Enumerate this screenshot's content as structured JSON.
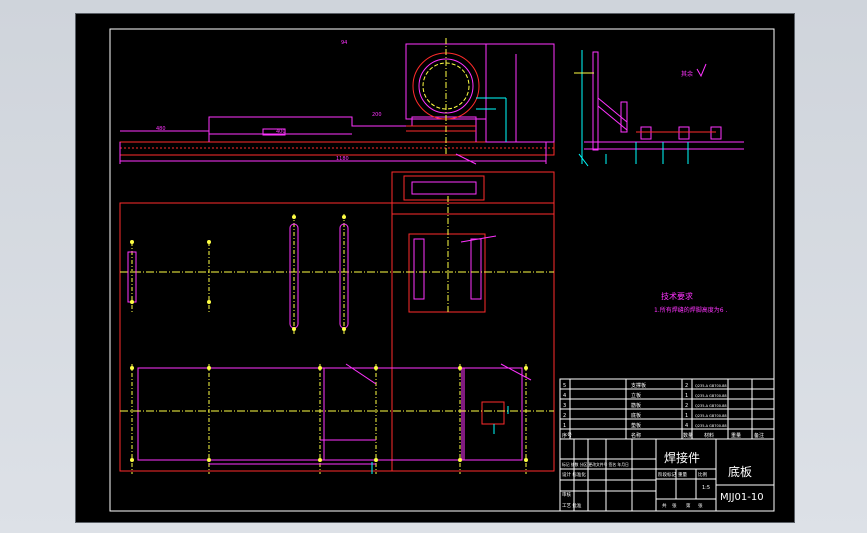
{
  "drawing": {
    "title_main": "焊接件",
    "part_name": "底板",
    "drawing_number": "MJJ01-10",
    "scale": "1:5",
    "roughness_note": "其余",
    "tech_requirements_title": "技术要求",
    "tech_requirements_line": "1.所有焊缝的焊脚高度为6 .",
    "dimensions": {
      "d_top": "94",
      "d_a": "480",
      "d_b": "200",
      "d_c": "400",
      "d_d": "400",
      "d_e": "1180",
      "d_f": "120"
    },
    "parts_list": {
      "rows": [
        {
          "no": "5",
          "name": "支撑板",
          "qty": "2",
          "material": "Q235-A GB700-88"
        },
        {
          "no": "4",
          "name": "立板",
          "qty": "1",
          "material": "Q235-A GB700-88"
        },
        {
          "no": "3",
          "name": "筋板",
          "qty": "2",
          "material": "Q235-A GB700-88"
        },
        {
          "no": "2",
          "name": "底板",
          "qty": "1",
          "material": "Q235-A GB700-88"
        },
        {
          "no": "1",
          "name": "垫板",
          "qty": "4",
          "material": "Q235-A GB700-88"
        }
      ],
      "header": {
        "no": "序号",
        "name": "名称",
        "qty": "数量",
        "material": "材料",
        "weight": "重量",
        "note": "备注"
      }
    },
    "title_block": {
      "left_rows": [
        "标记 处数 分区 更改文件号 签名 年月日",
        "设计 标准化",
        "审核",
        "工艺 批准"
      ],
      "mid_labels": [
        "阶段标记",
        "重量",
        "比例"
      ],
      "bottom_labels": [
        "共",
        "张",
        "第",
        "张"
      ]
    }
  }
}
